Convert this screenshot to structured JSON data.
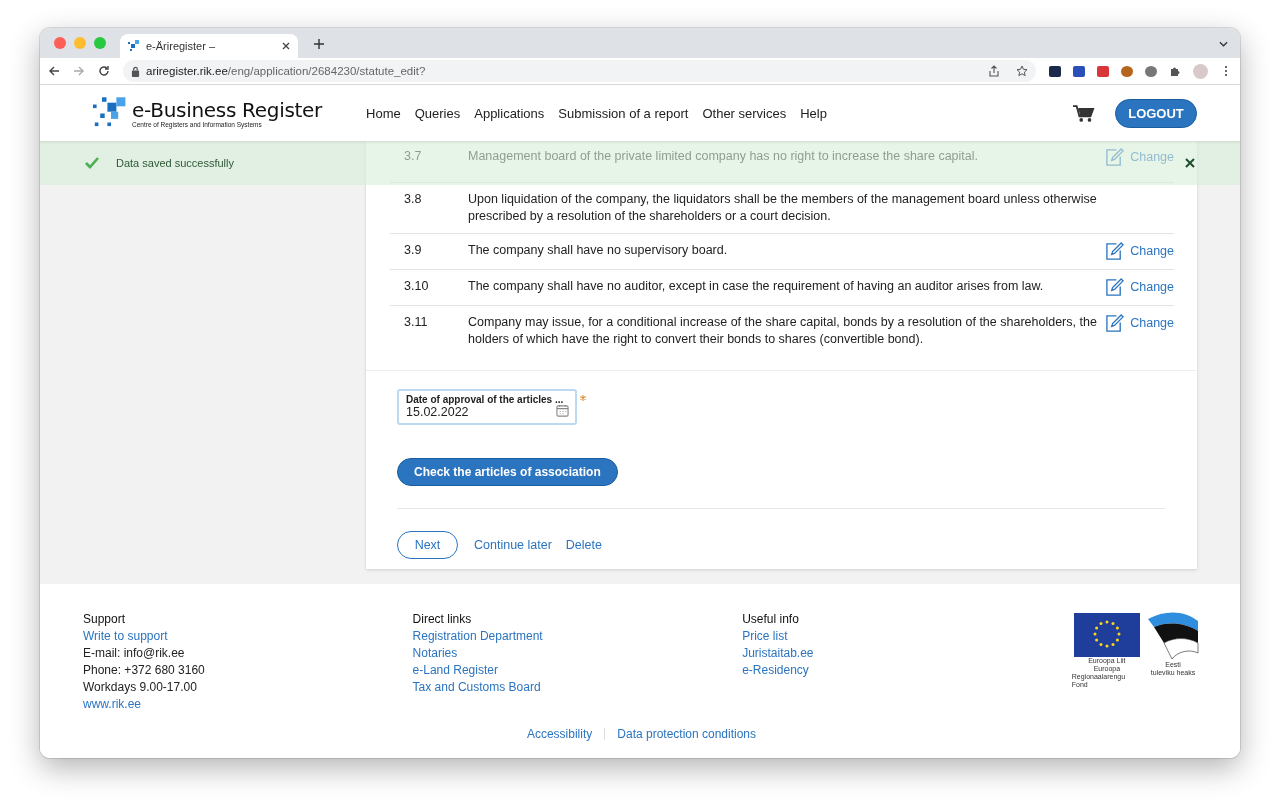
{
  "browser": {
    "tab_title": "e-Äriregister –",
    "url_host": "ariregister.rik.ee",
    "url_path": "/eng/application/2684230/statute_edit?"
  },
  "header": {
    "logo_title": "e-Business Register",
    "logo_subtitle": "Centre of Registers and Information Systems",
    "nav": [
      "Home",
      "Queries",
      "Applications",
      "Submission of a report",
      "Other services",
      "Help"
    ],
    "logout": "LOGOUT"
  },
  "notification": {
    "message": "Data saved successfully"
  },
  "articles": [
    {
      "number": "3.7",
      "text": "Management board of the private limited company has no right to increase the share capital.",
      "change": "Change"
    },
    {
      "number": "3.8",
      "text": "Upon liquidation of the company, the liquidators shall be the members of the management board unless otherwise prescribed by a resolution of the shareholders or a court decision."
    },
    {
      "number": "3.9",
      "text": "The company shall have no supervisory board.",
      "change": "Change"
    },
    {
      "number": "3.10",
      "text": "The company shall have no auditor, except in case the requirement of having an auditor arises from law.",
      "change": "Change"
    },
    {
      "number": "3.11",
      "text": "Company may issue, for a conditional increase of the share capital, bonds by a resolution of the shareholders, the holders of which have the right to convert their bonds to shares (convertible bond).",
      "change": "Change"
    }
  ],
  "date_field": {
    "label": "Date of approval of the articles ...",
    "value": "15.02.2022",
    "required": true
  },
  "check_button": "Check the articles of association",
  "actions": {
    "next": "Next",
    "continue_later": "Continue later",
    "delete": "Delete"
  },
  "footer": {
    "columns": [
      {
        "title": "Support",
        "lines": [
          {
            "kind": "link",
            "text": "Write to support"
          },
          {
            "kind": "text",
            "text": "E-mail: info@rik.ee"
          },
          {
            "kind": "text",
            "text": "Phone: +372 680 3160"
          },
          {
            "kind": "text",
            "text": "Workdays 9.00-17.00"
          },
          {
            "kind": "link",
            "text": "www.rik.ee"
          }
        ]
      },
      {
        "title": "Direct links",
        "lines": [
          {
            "kind": "link",
            "text": "Registration Department"
          },
          {
            "kind": "link",
            "text": "Notaries"
          },
          {
            "kind": "link",
            "text": "e-Land Register"
          },
          {
            "kind": "link",
            "text": "Tax and Customs Board"
          }
        ]
      },
      {
        "title": "Useful info",
        "lines": [
          {
            "kind": "link",
            "text": "Price list"
          },
          {
            "kind": "link",
            "text": "Juristaitab.ee"
          },
          {
            "kind": "link",
            "text": "e-Residency"
          }
        ]
      }
    ],
    "eu_logo_text": [
      "Euroopa Liit",
      "Euroopa",
      "Regionaalarengu Fond"
    ],
    "estonia_logo_text": [
      "Eesti",
      "tuleviku heaks"
    ],
    "bottom_links": [
      "Accessibility",
      "Data protection conditions"
    ]
  }
}
